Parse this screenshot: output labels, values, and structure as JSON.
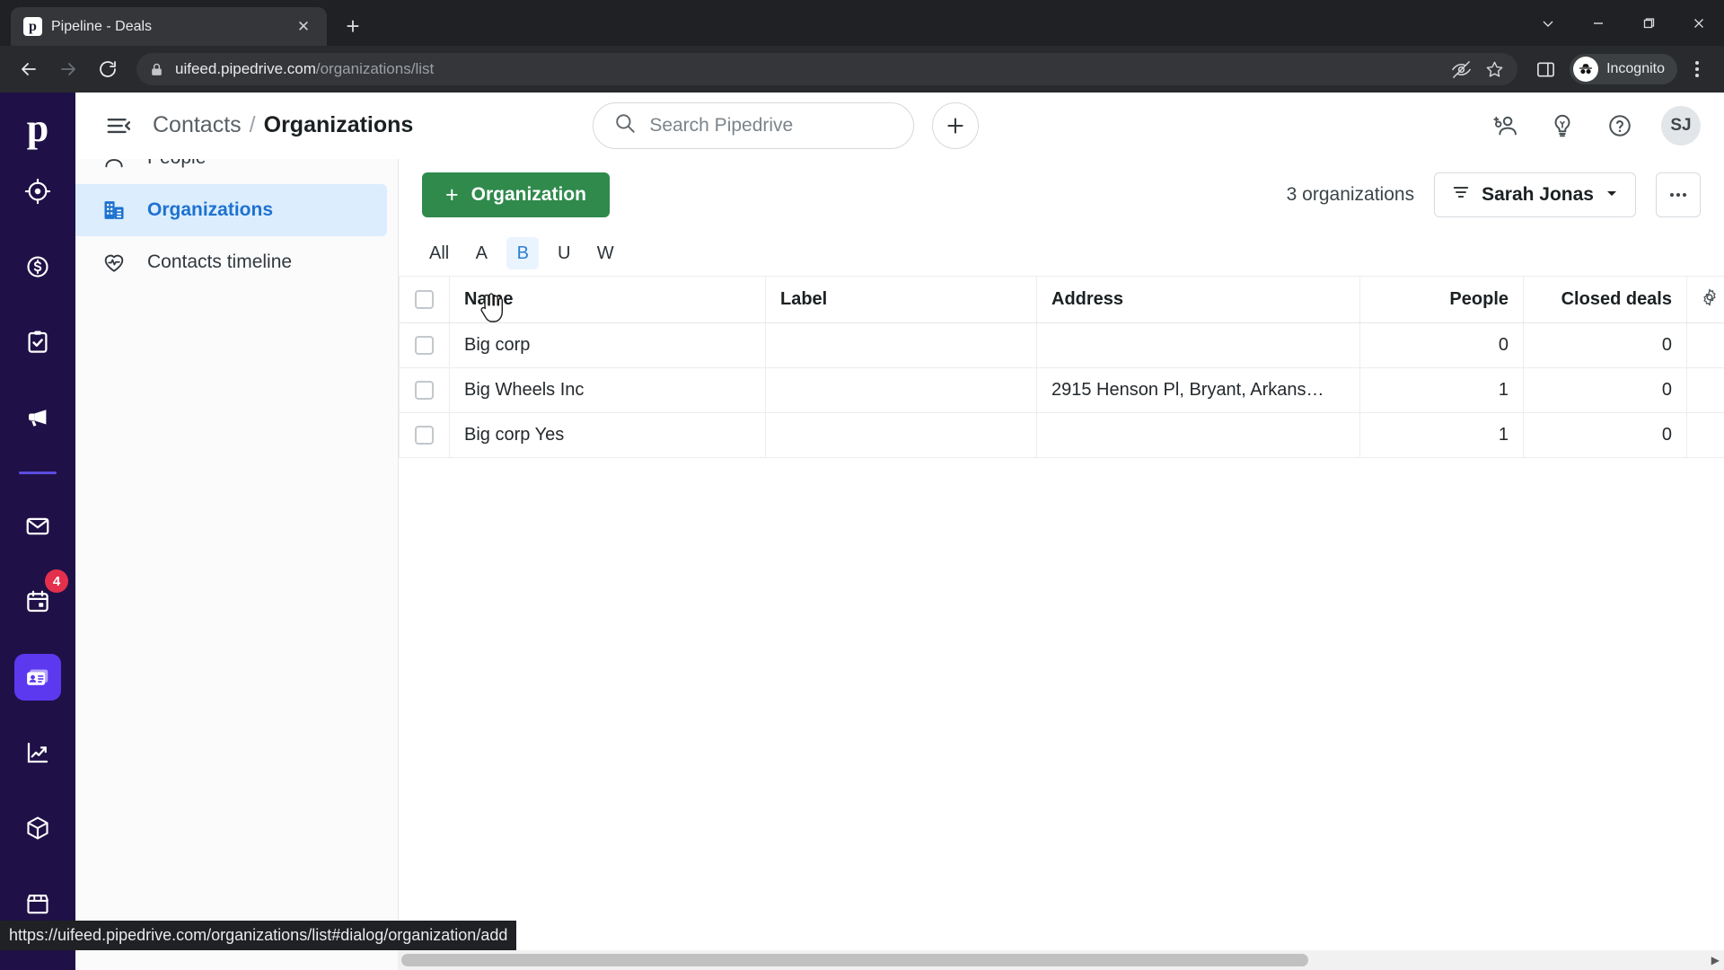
{
  "browser": {
    "tab": {
      "title": "Pipeline - Deals",
      "favicon_letter": "p",
      "close_label": "✕"
    },
    "new_tab_label": "+",
    "window_controls": {
      "minimize_tabs": "chevron-down",
      "minimize": "minimize",
      "maximize": "maximize",
      "close": "close"
    },
    "nav": {
      "back": "back-arrow",
      "forward": "forward-arrow",
      "reload": "reload"
    },
    "address": {
      "host": "uifeed.pipedrive.com",
      "path": "/organizations/list",
      "lock": "lock-icon"
    },
    "omnibox_icons": [
      "eye-off-icon",
      "star-icon"
    ],
    "side_panel": "side-panel-icon",
    "profile": {
      "label": "Incognito",
      "icon": "incognito-icon"
    },
    "menu": "kebab-menu",
    "status_url": "https://uifeed.pipedrive.com/organizations/list#dialog/organization/add"
  },
  "rail": {
    "logo": "p",
    "items": [
      {
        "name": "leads",
        "icon": "target-icon"
      },
      {
        "name": "deals",
        "icon": "dollar-circle-icon"
      },
      {
        "name": "activities",
        "icon": "clipboard-check-icon"
      },
      {
        "name": "campaigns",
        "icon": "megaphone-icon"
      },
      {
        "name": "mail",
        "icon": "mail-icon"
      },
      {
        "name": "calendar",
        "icon": "calendar-icon",
        "badge": "4"
      },
      {
        "name": "contacts",
        "icon": "contact-card-icon",
        "active": true
      },
      {
        "name": "insights",
        "icon": "chart-line-icon"
      },
      {
        "name": "products",
        "icon": "box-icon"
      },
      {
        "name": "marketplace",
        "icon": "store-icon"
      }
    ]
  },
  "subnav": {
    "items": [
      {
        "label": "People",
        "icon": "person-icon",
        "active": false
      },
      {
        "label": "Organizations",
        "icon": "building-icon",
        "active": true
      },
      {
        "label": "Contacts timeline",
        "icon": "heart-pulse-icon",
        "active": false
      }
    ]
  },
  "header": {
    "menu_toggle": "collapse-sidebar-icon",
    "breadcrumb_parent": "Contacts",
    "breadcrumb_sep": "/",
    "breadcrumb_current": "Organizations",
    "search_placeholder": "Search Pipedrive",
    "add_label": "+",
    "icons": [
      "add-user-icon",
      "lightbulb-icon",
      "help-icon"
    ],
    "avatar_initials": "SJ"
  },
  "toolbar": {
    "add_button_label": "Organization",
    "add_button_plus": "+",
    "count_label": "3 organizations",
    "filter_label": "Sarah Jonas",
    "more_label": "…"
  },
  "alpha_filter": {
    "items": [
      "All",
      "A",
      "B",
      "U",
      "W"
    ],
    "selected": "B"
  },
  "table": {
    "columns": [
      "Name",
      "Label",
      "Address",
      "People",
      "Closed deals"
    ],
    "settings_icon": "gear-icon",
    "rows": [
      {
        "name": "Big corp",
        "label": "",
        "address": "",
        "people": "0",
        "closed_deals": "0"
      },
      {
        "name": "Big Wheels Inc",
        "label": "",
        "address": "2915 Henson Pl, Bryant, Arkans…",
        "people": "1",
        "closed_deals": "0"
      },
      {
        "name": "Big corp Yes",
        "label": "",
        "address": "",
        "people": "1",
        "closed_deals": "0"
      }
    ]
  },
  "colors": {
    "brand_dark": "#1f1147",
    "brand_active": "#5c38ef",
    "accent_blue": "#1e72d0",
    "green_button": "#2f8a4c",
    "badge_red": "#e4304c"
  }
}
